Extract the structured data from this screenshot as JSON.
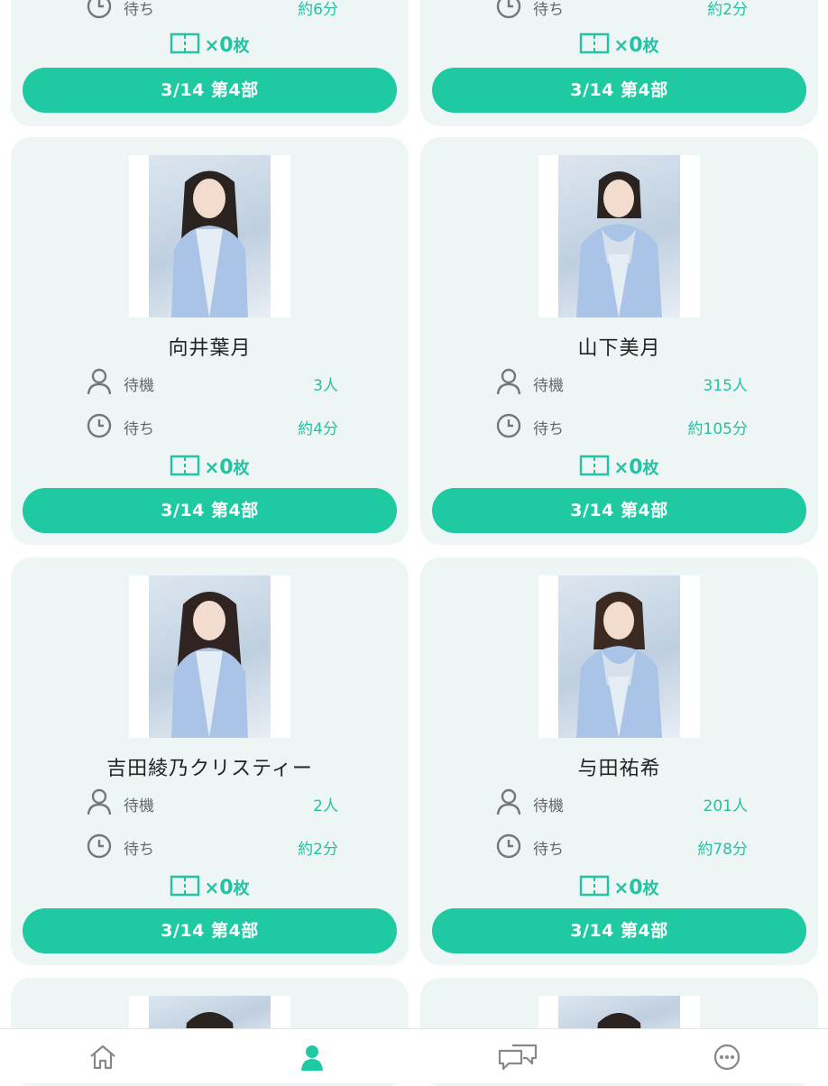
{
  "labels": {
    "waiting": "待機",
    "wait_time": "待ち"
  },
  "ticket": {
    "x": "×",
    "count": "0",
    "unit": "枚"
  },
  "session_button": "3/14 第4部",
  "cards": [
    {
      "name": "",
      "waiting_count": "",
      "wait_time": "約6分"
    },
    {
      "name": "",
      "waiting_count": "",
      "wait_time": "約2分"
    },
    {
      "name": "向井葉月",
      "waiting_count": "3人",
      "wait_time": "約4分"
    },
    {
      "name": "山下美月",
      "waiting_count": "315人",
      "wait_time": "約105分"
    },
    {
      "name": "吉田綾乃クリスティー",
      "waiting_count": "2人",
      "wait_time": "約2分"
    },
    {
      "name": "与田祐希",
      "waiting_count": "201人",
      "wait_time": "約78分"
    }
  ],
  "nav": {
    "items": [
      {
        "icon": "home-icon"
      },
      {
        "icon": "person-icon",
        "active": true
      },
      {
        "icon": "chat-icon"
      },
      {
        "icon": "more-icon"
      }
    ],
    "active_color": "#1fcaa3",
    "inactive_color": "#888888"
  },
  "colors": {
    "accent": "#1fcaa3",
    "card_bg": "#eef5f5",
    "value_text": "#22c3a3"
  }
}
